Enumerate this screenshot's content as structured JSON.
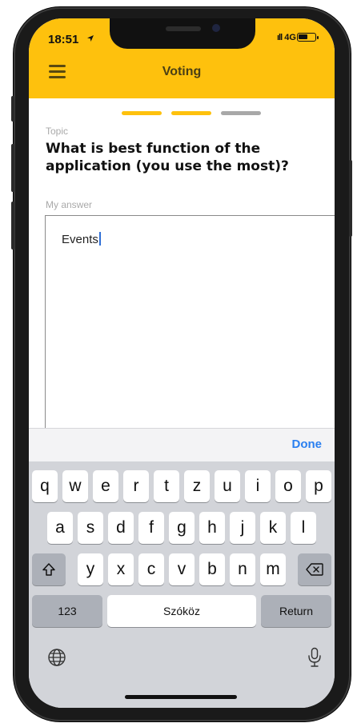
{
  "status_bar": {
    "time": "18:51",
    "network": "4G"
  },
  "header": {
    "title": "Voting",
    "background": "#fec10d"
  },
  "progress": {
    "steps": 3,
    "completed": 2,
    "active_color": "#fec10d",
    "inactive_color": "#a8a8a8"
  },
  "topic": {
    "label": "Topic",
    "question": "What is best function of the application (you use the most)?"
  },
  "answer": {
    "label": "My answer",
    "value": "Events"
  },
  "keyboard": {
    "done_label": "Done",
    "row1": [
      "q",
      "w",
      "e",
      "r",
      "t",
      "z",
      "u",
      "i",
      "o",
      "p"
    ],
    "row2": [
      "a",
      "s",
      "d",
      "f",
      "g",
      "h",
      "j",
      "k",
      "l"
    ],
    "row3": [
      "y",
      "x",
      "c",
      "v",
      "b",
      "n",
      "m"
    ],
    "numbers_label": "123",
    "space_label": "Szóköz",
    "return_label": "Return"
  }
}
